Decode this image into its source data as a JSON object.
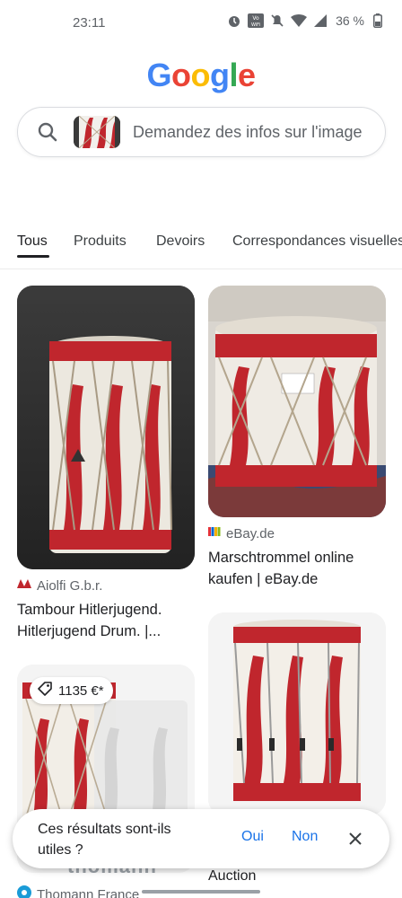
{
  "status": {
    "time": "23:11",
    "battery": "36 %",
    "icons": [
      "alarm-icon",
      "vowifi-icon",
      "mute-icon",
      "wifi-icon",
      "signal-icon",
      "battery-icon"
    ]
  },
  "logo": {
    "letters": [
      "G",
      "o",
      "o",
      "g",
      "l",
      "e"
    ],
    "colors": [
      "#4285F4",
      "#EA4335",
      "#FBBC05",
      "#4285F4",
      "#34A853",
      "#EA4335"
    ]
  },
  "search": {
    "placeholder": "Demandez des infos sur l'image"
  },
  "tabs": [
    {
      "label": "Tous",
      "active": true
    },
    {
      "label": "Produits",
      "active": false
    },
    {
      "label": "Devoirs",
      "active": false
    },
    {
      "label": "Correspondances visuelles",
      "active": false
    }
  ],
  "results": [
    {
      "source": "Aiolfi G.b.r.",
      "title_line1": "Tambour Hitlerjugend.",
      "title_line2": "Hitlerjugend Drum. |..."
    },
    {
      "source": "eBay.de",
      "title_line1": "Marschtrommel online",
      "title_line2": "kaufen | eBay.de"
    },
    {
      "price": "1135 €*",
      "watermark": "thomann",
      "source": "Thomann France"
    },
    {
      "title_line1": "Auction"
    }
  ],
  "feedback": {
    "question": "Ces résultats sont-ils utiles ?",
    "yes": "Oui",
    "no": "Non"
  }
}
